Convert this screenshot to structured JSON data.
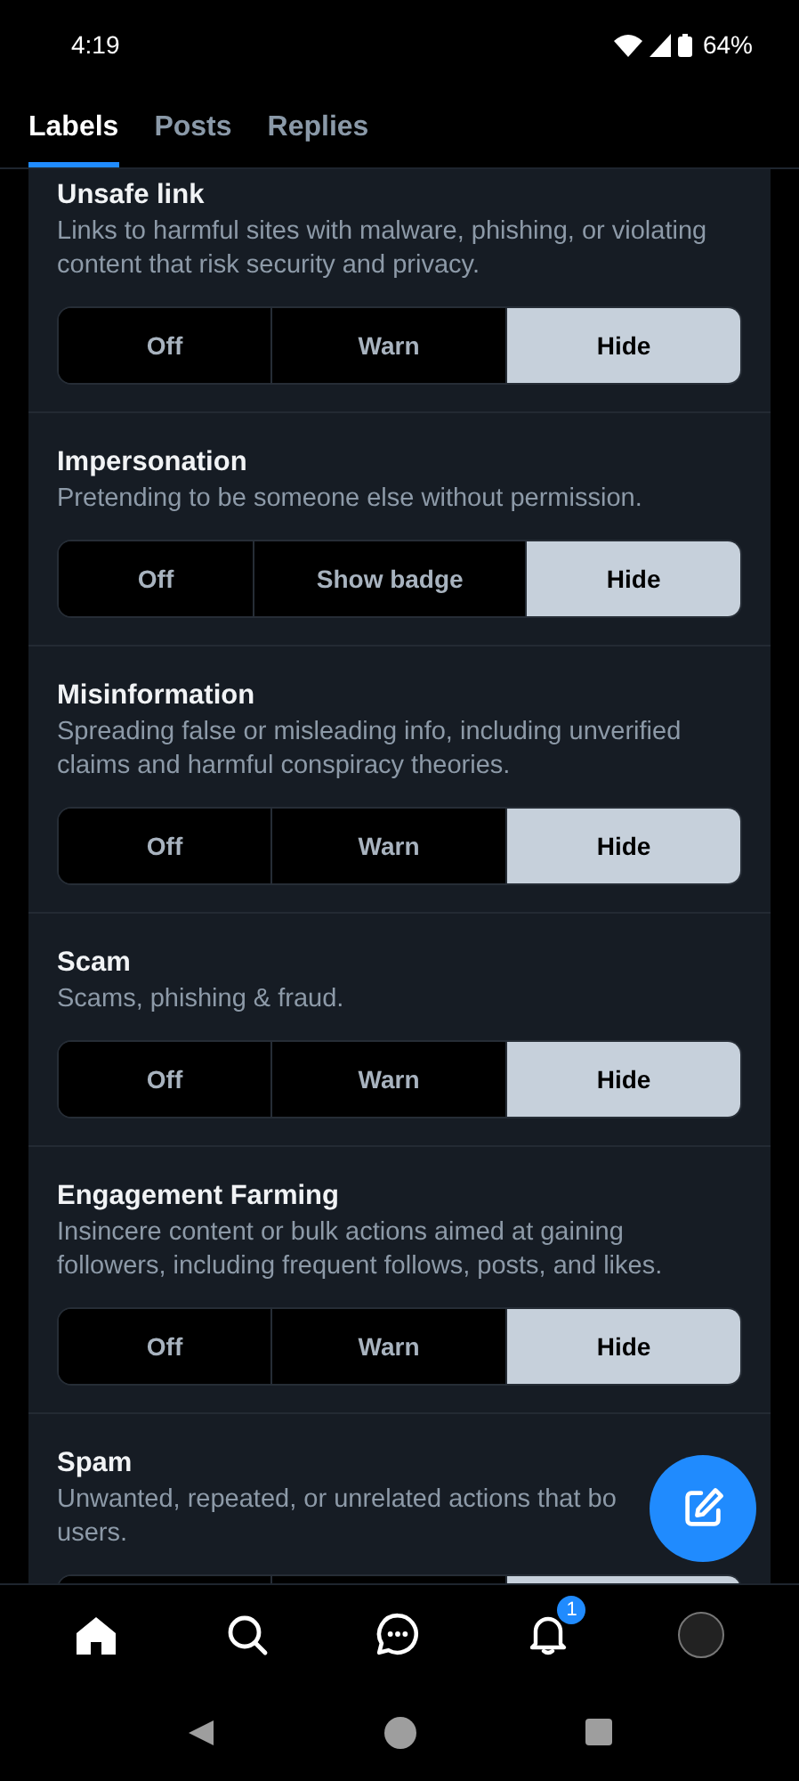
{
  "status_bar": {
    "time": "4:19",
    "battery": "64%"
  },
  "tabs": [
    {
      "label": "Labels",
      "selected": true
    },
    {
      "label": "Posts",
      "selected": false
    },
    {
      "label": "Replies",
      "selected": false
    }
  ],
  "sections": [
    {
      "title": "Unsafe link",
      "description": "Links to harmful sites with malware, phishing, or violating content that risk security and privacy.",
      "options": [
        {
          "label": "Off",
          "selected": false
        },
        {
          "label": "Warn",
          "selected": false
        },
        {
          "label": "Hide",
          "selected": true
        }
      ]
    },
    {
      "title": "Impersonation",
      "description": "Pretending to be someone else without permission.",
      "options": [
        {
          "label": "Off",
          "selected": false
        },
        {
          "label": "Show badge",
          "selected": false
        },
        {
          "label": "Hide",
          "selected": true
        }
      ]
    },
    {
      "title": "Misinformation",
      "description": "Spreading false or misleading info, including unverified claims and harmful conspiracy theories.",
      "options": [
        {
          "label": "Off",
          "selected": false
        },
        {
          "label": "Warn",
          "selected": false
        },
        {
          "label": "Hide",
          "selected": true
        }
      ]
    },
    {
      "title": "Scam",
      "description": "Scams, phishing & fraud.",
      "options": [
        {
          "label": "Off",
          "selected": false
        },
        {
          "label": "Warn",
          "selected": false
        },
        {
          "label": "Hide",
          "selected": true
        }
      ]
    },
    {
      "title": "Engagement Farming",
      "description": "Insincere content or bulk actions aimed at gaining followers, including frequent follows, posts, and likes.",
      "options": [
        {
          "label": "Off",
          "selected": false
        },
        {
          "label": "Warn",
          "selected": false
        },
        {
          "label": "Hide",
          "selected": true
        }
      ]
    },
    {
      "title": "Spam",
      "description": "Unwanted, repeated, or unrelated actions that bo\nusers.",
      "options": [
        {
          "selected": false
        },
        {
          "selected": false
        },
        {
          "selected": true
        }
      ]
    }
  ],
  "bottom_nav": {
    "notifications_badge": "1"
  }
}
